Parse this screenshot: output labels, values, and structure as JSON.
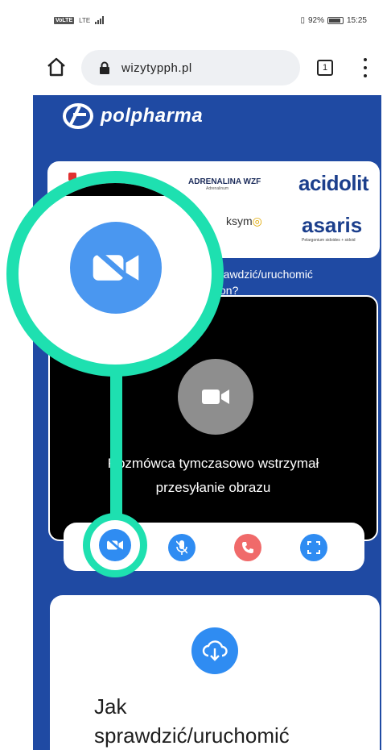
{
  "statusbar": {
    "volte": "VoLTE",
    "network": "LTE",
    "battery_pct": "92%",
    "time": "15:25"
  },
  "browser": {
    "url": "wizytypph.pl",
    "tab_count": "1",
    "icons": [
      "home-icon",
      "lock-icon",
      "tabs-icon",
      "more-vert-icon"
    ]
  },
  "brand": {
    "name": "polpharma"
  },
  "logos": {
    "adrenalina": "ADRENALINA WZF",
    "adrenalina_sub": "Adrenalinum",
    "acidolit": "acidolit",
    "oksym": "ksym",
    "asaris": "asaris",
    "asaris_sub": "Pelargonium sidoides + sidoid"
  },
  "question_fragment": {
    "line1": "rawdzić/uruchomić",
    "line2": "on?"
  },
  "video": {
    "message_line1": "Rozmówca tymczasowo wstrzymał",
    "message_line2": "przesyłanie obrazu",
    "icon": "video-camera-icon"
  },
  "controls": {
    "buttons": [
      {
        "name": "video-off-button",
        "icon": "video-off-icon"
      },
      {
        "name": "mic-off-button",
        "icon": "mic-off-icon"
      },
      {
        "name": "hangup-button",
        "icon": "phone-icon"
      },
      {
        "name": "fullscreen-button",
        "icon": "fullscreen-icon"
      }
    ]
  },
  "card2": {
    "icon": "cloud-download-icon",
    "title_line1": "Jak",
    "title_line2": "sprawdzić/uruchomić"
  },
  "colors": {
    "page_blue": "#1f4aa3",
    "button_blue": "#2f8cf2",
    "hangup_red": "#f06a6a",
    "highlight_teal": "#1ee0b0"
  }
}
